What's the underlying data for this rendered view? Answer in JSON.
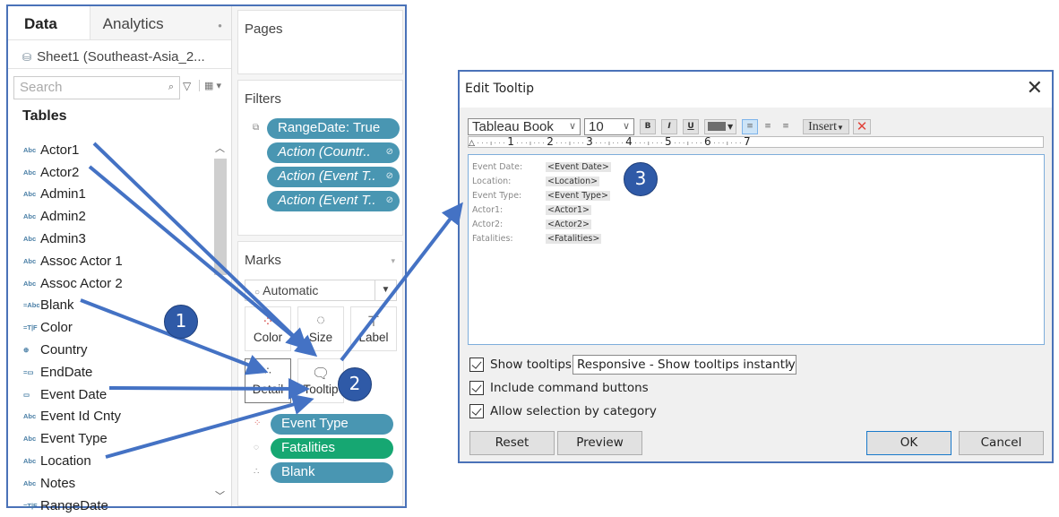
{
  "data_pane": {
    "tabs": [
      {
        "label": "Data",
        "active": true
      },
      {
        "label": "Analytics",
        "active": false
      }
    ],
    "source": "Sheet1 (Southeast-Asia_2...",
    "search_placeholder": "Search",
    "tables_label": "Tables",
    "fields": [
      {
        "type": "Abc",
        "name": "Actor1"
      },
      {
        "type": "Abc",
        "name": "Actor2"
      },
      {
        "type": "Abc",
        "name": "Admin1"
      },
      {
        "type": "Abc",
        "name": "Admin2"
      },
      {
        "type": "Abc",
        "name": "Admin3"
      },
      {
        "type": "Abc",
        "name": "Assoc Actor 1"
      },
      {
        "type": "Abc",
        "name": "Assoc Actor 2"
      },
      {
        "type": "=Abc",
        "name": "Blank"
      },
      {
        "type": "=T|F",
        "name": "Color"
      },
      {
        "type": "⊕",
        "name": "Country"
      },
      {
        "type": "=▭",
        "name": "EndDate"
      },
      {
        "type": "▭",
        "name": "Event Date"
      },
      {
        "type": "Abc",
        "name": "Event Id Cnty"
      },
      {
        "type": "Abc",
        "name": "Event Type"
      },
      {
        "type": "Abc",
        "name": "Location"
      },
      {
        "type": "Abc",
        "name": "Notes"
      },
      {
        "type": "=T|F",
        "name": "RangeDate"
      }
    ]
  },
  "shelves": {
    "pages_title": "Pages",
    "filters_title": "Filters",
    "filters": [
      {
        "label": "RangeDate: True",
        "italic": false
      },
      {
        "label": "Action (Countr..",
        "italic": true
      },
      {
        "label": "Action (Event T..",
        "italic": true
      },
      {
        "label": "Action (Event T..",
        "italic": true
      }
    ],
    "marks_title": "Marks",
    "mark_type": "Automatic",
    "mark_buttons": [
      "Color",
      "Size",
      "Label",
      "Detail",
      "Tooltip"
    ],
    "mark_pills": [
      {
        "label": "Event Type",
        "encoding": "color",
        "color": "#4996b2"
      },
      {
        "label": "Fatalities",
        "encoding": "size",
        "color": "#16a772"
      },
      {
        "label": "Blank",
        "encoding": "detail",
        "color": "#4996b2"
      }
    ]
  },
  "dialog": {
    "title": "Edit Tooltip",
    "font": "Tableau Book",
    "size": "10",
    "format_buttons": [
      "B",
      "I",
      "U"
    ],
    "insert_label": "Insert",
    "ruler_marks": [
      "1",
      "2",
      "3",
      "4",
      "5",
      "6",
      "7"
    ],
    "tooltip_rows": [
      {
        "label": "Event Date:",
        "value": "<Event Date>"
      },
      {
        "label": "Location:",
        "value": "<Location>"
      },
      {
        "label": "Event Type:",
        "value": "<Event Type>"
      },
      {
        "label": "Actor1:",
        "value": "<Actor1>"
      },
      {
        "label": "Actor2:",
        "value": "<Actor2>"
      },
      {
        "label": "Fatalities:",
        "value": "<Fatalities>"
      }
    ],
    "show_tooltips": {
      "label": "Show tooltips",
      "checked": true
    },
    "tooltip_mode": "Responsive - Show tooltips instantly",
    "include_command_buttons": {
      "label": "Include command buttons",
      "checked": true
    },
    "allow_selection": {
      "label": "Allow selection by category",
      "checked": true
    },
    "buttons": {
      "reset": "Reset",
      "preview": "Preview",
      "ok": "OK",
      "cancel": "Cancel"
    }
  },
  "annotations": {
    "badges": [
      "1",
      "2",
      "3"
    ],
    "arrow_color": "#4472c4"
  }
}
